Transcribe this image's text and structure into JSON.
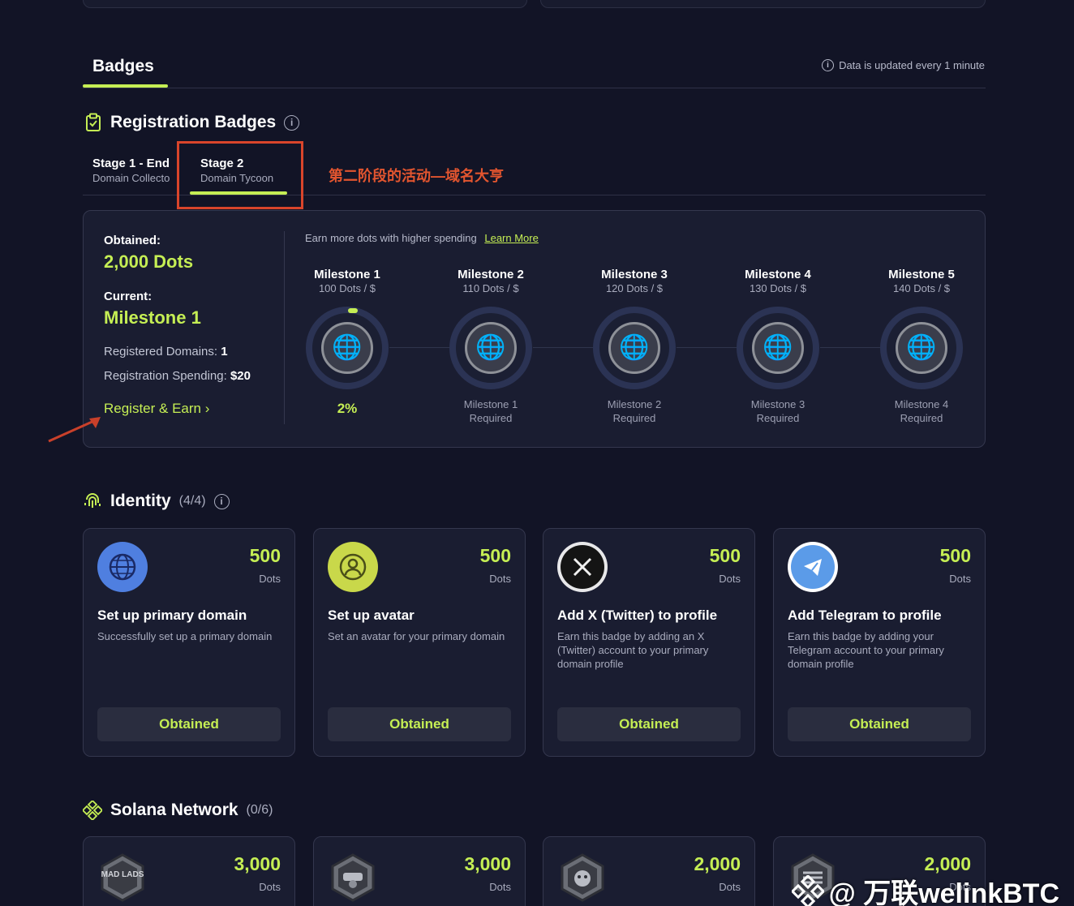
{
  "header": {
    "tab_badges": "Badges",
    "update_note": "Data is updated every 1 minute"
  },
  "registration": {
    "title": "Registration Badges",
    "stages": [
      {
        "title": "Stage 1 - End",
        "subtitle": "Domain Collecto"
      },
      {
        "title": "Stage 2",
        "subtitle": "Domain Tycoon"
      }
    ],
    "annotation_cn": "第二阶段的活动—域名大亨",
    "obtained_label": "Obtained:",
    "obtained_value": "2,000 Dots",
    "current_label": "Current:",
    "current_value": "Milestone 1",
    "registered_domains_label": "Registered Domains:",
    "registered_domains_value": "1",
    "spending_label": "Registration Spending:",
    "spending_value": "$20",
    "register_link": "Register & Earn ›",
    "earn_note": "Earn more dots with higher spending",
    "learn_more": "Learn More",
    "milestones": [
      {
        "title": "Milestone 1",
        "rate": "100 Dots / $",
        "footer": "2%",
        "progress": 0.02
      },
      {
        "title": "Milestone 2",
        "rate": "110 Dots / $",
        "footer_line1": "Milestone 1",
        "footer_line2": "Required"
      },
      {
        "title": "Milestone 3",
        "rate": "120 Dots / $",
        "footer_line1": "Milestone 2",
        "footer_line2": "Required"
      },
      {
        "title": "Milestone 4",
        "rate": "130 Dots / $",
        "footer_line1": "Milestone 3",
        "footer_line2": "Required"
      },
      {
        "title": "Milestone 5",
        "rate": "140 Dots / $",
        "footer_line1": "Milestone 4",
        "footer_line2": "Required"
      }
    ]
  },
  "identity": {
    "title": "Identity",
    "count": "(4/4)",
    "cards": [
      {
        "points": "500",
        "unit": "Dots",
        "title": "Set up primary domain",
        "desc": "Successfully set up a primary domain",
        "button": "Obtained",
        "icon": "globe-icon",
        "icon_color": "#4f7fe0"
      },
      {
        "points": "500",
        "unit": "Dots",
        "title": "Set up avatar",
        "desc": "Set an avatar for your primary domain",
        "button": "Obtained",
        "icon": "avatar-icon",
        "icon_color": "#c9d84a"
      },
      {
        "points": "500",
        "unit": "Dots",
        "title": "Add X (Twitter) to profile",
        "desc": "Earn this badge by adding an X (Twitter) account to your primary domain profile",
        "button": "Obtained",
        "icon": "x-logo-icon",
        "icon_color": "#e8e8ea"
      },
      {
        "points": "500",
        "unit": "Dots",
        "title": "Add Telegram to profile",
        "desc": "Earn this badge by adding your Telegram account to your primary domain profile",
        "button": "Obtained",
        "icon": "telegram-icon",
        "icon_color": "#5b9be8"
      }
    ]
  },
  "solana": {
    "title": "Solana Network",
    "count": "(0/6)",
    "cards": [
      {
        "points": "3,000",
        "unit": "Dots",
        "icon": "mad-lads-icon",
        "logo_text": "MAD LADS"
      },
      {
        "points": "3,000",
        "unit": "Dots",
        "icon": "robot-hex-icon"
      },
      {
        "points": "2,000",
        "unit": "Dots",
        "icon": "monkey-hex-icon"
      },
      {
        "points": "2,000",
        "unit": "Dots",
        "icon": "stripes-hex-icon"
      }
    ]
  },
  "watermark": "@ 万联welinkBTC",
  "colors": {
    "accent": "#c5ee54",
    "background": "#121426",
    "panel": "#1a1d31",
    "annotation": "#d9452b"
  }
}
